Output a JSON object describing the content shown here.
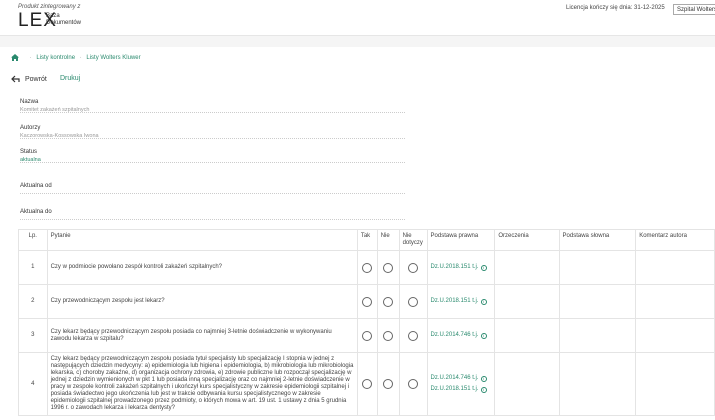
{
  "header": {
    "product_line": "Produkt zintegrowany z",
    "logo": "LEX",
    "logo_sub1": "Baza",
    "logo_sub2": "Dokumentów",
    "license": "Licencja kończy się dnia: 31-12-2025",
    "org_button": "Szpital Wolters"
  },
  "breadcrumb": [
    "Listy kontrolne",
    "Listy Wolters Kluwer"
  ],
  "toolbar": {
    "back": "Powrót",
    "print": "Drukuj"
  },
  "fields": [
    {
      "label": "Nazwa",
      "value": "Komitet zakażeń szpitalnych"
    },
    {
      "label": "Autorzy",
      "value": "Kaczorowska-Kossowska Iwona"
    },
    {
      "label": "Status",
      "value": "aktualna"
    },
    {
      "label": "Aktualna od",
      "value": ""
    },
    {
      "label": "Aktualna do",
      "value": ""
    }
  ],
  "table": {
    "headers": [
      "Lp.",
      "Pytanie",
      "Tak",
      "Nie",
      "Nie dotyczy",
      "Podstawa prawna",
      "Orzeczenia",
      "Podstawa słowna",
      "Komentarz autora"
    ],
    "rows": [
      {
        "lp": "1",
        "question": "Czy w podmiocie powołano zespół kontroli zakażeń szpitalnych?",
        "legal": [
          "Dz.U.2018.151 t.j."
        ]
      },
      {
        "lp": "2",
        "question": "Czy przewodniczącym zespołu jest lekarz?",
        "legal": [
          "Dz.U.2018.151 t.j."
        ]
      },
      {
        "lp": "3",
        "question": "Czy lekarz będący przewodniczącym zespołu posiada co najmniej 3-letnie doświadczenie w wykonywaniu zawodu lekarza w szpitalu?",
        "legal": [
          "Dz.U.2014.746 t.j."
        ]
      },
      {
        "lp": "4",
        "question": "Czy lekarz będący przewodniczącym zespołu posiada tytuł specjalisty lub specjalizację I stopnia w jednej z następujących dziedzin medycyny: a) epidemiologia lub higiena i epidemiologia, b) mikrobiologia lub mikrobiologia lekarska, c) choroby zakaźne, d) organizacja ochrony zdrowia, e) zdrowie publiczne lub rozpoczął specjalizację w jednej z dziedzin wymienionych w pkt 1 lub posiada inną specjalizację oraz co najmniej 2-letnie doświadczenie w pracy w zespole kontroli zakażeń szpitalnych i ukończył kurs specjalistyczny w zakresie epidemiologii szpitalnej i posiada świadectwo jego ukończenia lub jest w trakcie odbywania kursu specjalistycznego w zakresie epidemiologii szpitalnej prowadzonego przez podmioty, o których mowa w art. 19 ust. 1 ustawy z dnia 5 grudnia 1996 r. o zawodach lekarza i lekarza dentysty?",
        "legal": [
          "Dz.U.2014.746 t.j.",
          "Dz.U.2018.151 t.j."
        ]
      }
    ]
  }
}
